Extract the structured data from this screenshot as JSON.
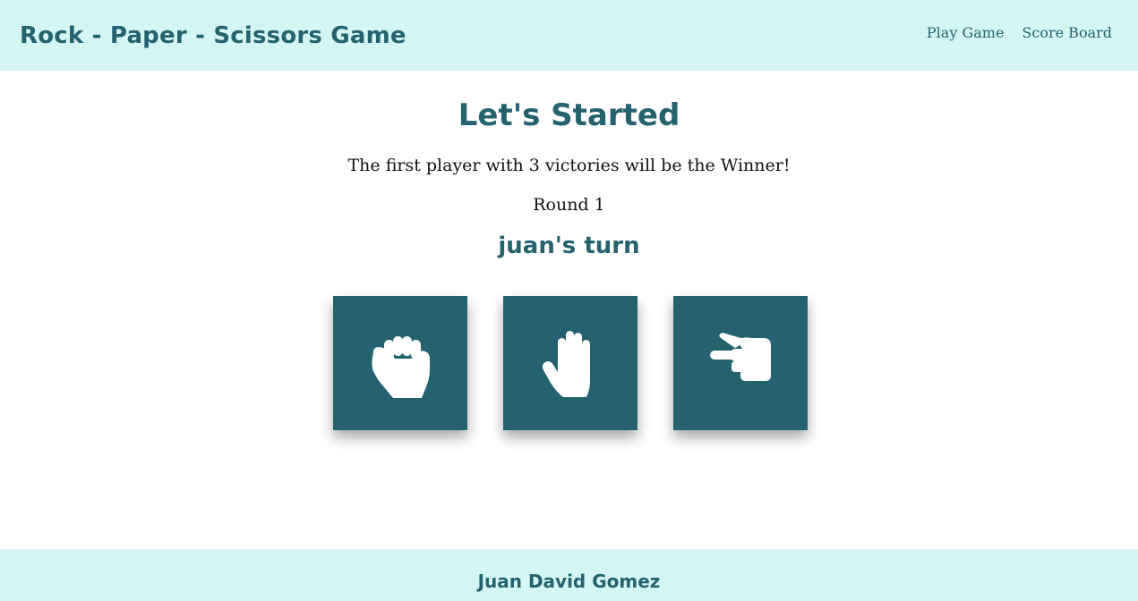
{
  "header": {
    "brand": "Rock - Paper - Scissors Game",
    "nav": [
      "Play Game",
      "Score Board"
    ]
  },
  "main": {
    "title": "Let's Started",
    "rule": "The first player with 3 victories will be the Winner!",
    "round": "Round 1",
    "turn": "juan's turn",
    "choices": [
      {
        "name": "rock",
        "icon": "fist-icon"
      },
      {
        "name": "paper",
        "icon": "open-hand-icon"
      },
      {
        "name": "scissors",
        "icon": "scissors-hand-icon"
      }
    ]
  },
  "footer": {
    "author": "Juan David Gomez"
  },
  "colors": {
    "accent": "#246270",
    "header_bg": "#d4f5f4",
    "icon": "#ffffff"
  }
}
